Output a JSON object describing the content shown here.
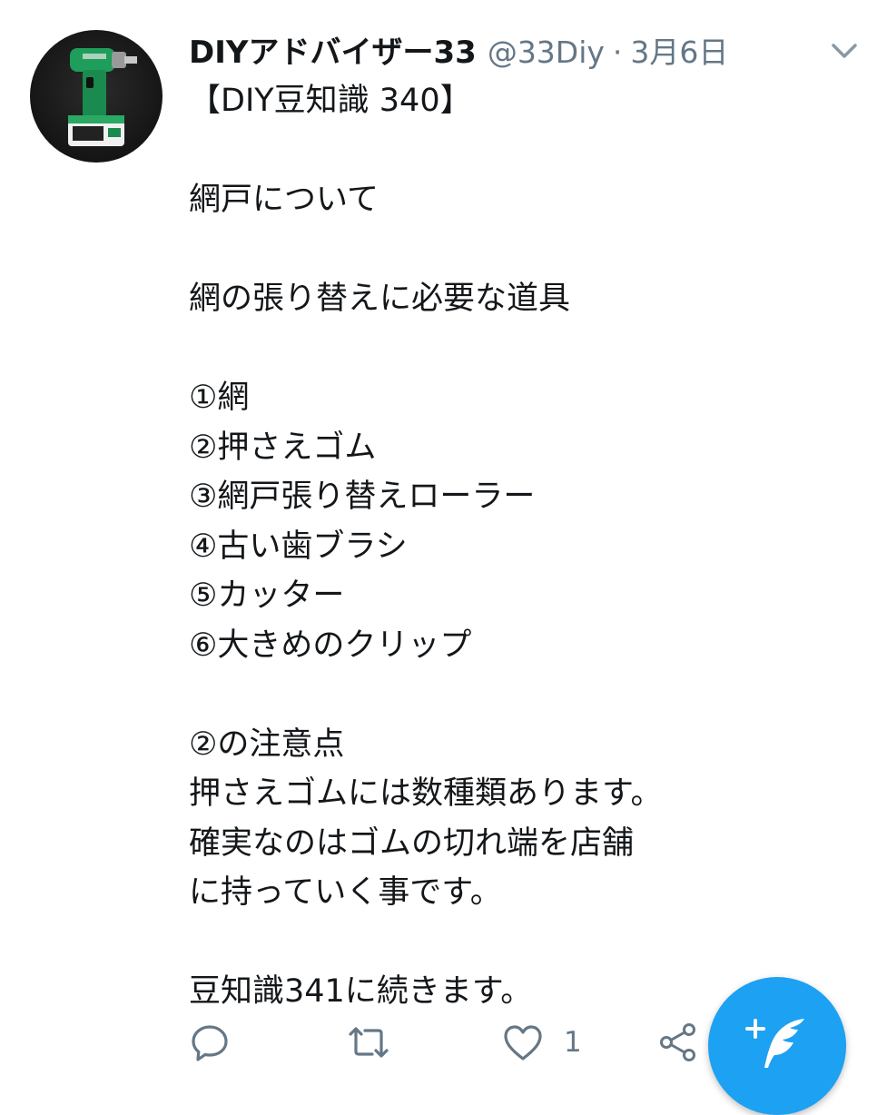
{
  "tweet": {
    "author": {
      "name": "DIYアドバイザー33",
      "handle": "@33Diy",
      "avatar_icon": "impact-driver-avatar"
    },
    "separator": "·",
    "date": "3月6日",
    "lines": [
      "【DIY豆知識 340】",
      "",
      "網戸について",
      "",
      "網の張り替えに必要な道具",
      "",
      "①網",
      "②押さえゴム",
      "③網戸張り替えローラー",
      "④古い歯ブラシ",
      "⑤カッター",
      "⑥大きめのクリップ",
      "",
      "②の注意点",
      "押さえゴムには数種類あります。",
      "確実なのはゴムの切れ端を店舗",
      "に持っていく事です。",
      "",
      "豆知識341に続きます。"
    ]
  },
  "actions": {
    "reply_icon": "reply-icon",
    "retweet_icon": "retweet-icon",
    "like_icon": "heart-icon",
    "like_count": "1",
    "share_icon": "share-icon"
  },
  "fab": {
    "icon": "compose-tweet-icon"
  },
  "colors": {
    "text_primary": "#14171a",
    "text_secondary": "#657786",
    "accent": "#1da1f2"
  }
}
